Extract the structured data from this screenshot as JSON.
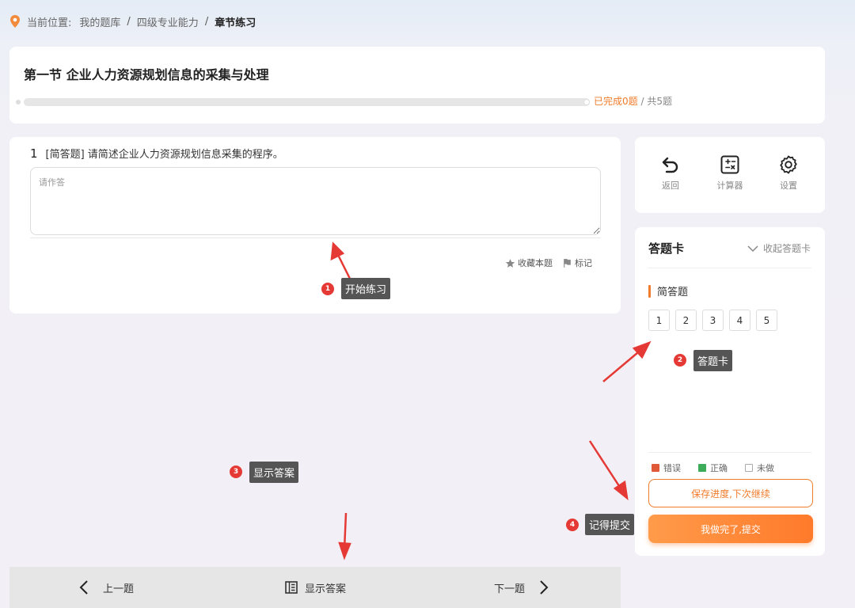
{
  "breadcrumb": {
    "prefix": "当前位置:",
    "items": [
      "我的题库",
      "四级专业能力",
      "章节练习"
    ]
  },
  "section": {
    "title": "第一节 企业人力资源规划信息的采集与处理",
    "progress_done": "已完成0题",
    "progress_sep": " / ",
    "progress_total": "共5题",
    "progress_fraction": 0
  },
  "question": {
    "number": "1",
    "type": "[简答题]",
    "text": "请简述企业人力资源规划信息采集的程序。",
    "placeholder": "请作答",
    "favorite_label": "收藏本题",
    "mark_label": "标记"
  },
  "tools": [
    {
      "label": "返回",
      "icon": "undo-icon"
    },
    {
      "label": "计算器",
      "icon": "calculator-icon"
    },
    {
      "label": "设置",
      "icon": "gear-icon"
    }
  ],
  "answer_sheet": {
    "title": "答题卡",
    "collapse_label": "收起答题卡",
    "section_label": "简答题",
    "numbers": [
      "1",
      "2",
      "3",
      "4",
      "5"
    ],
    "legend": [
      {
        "label": "错误",
        "color": "#e05a3a"
      },
      {
        "label": "正确",
        "color": "#3cab5a"
      },
      {
        "label": "未做",
        "color": "#ffffff"
      }
    ],
    "save_label": "保存进度,下次继续",
    "submit_label": "我做完了,提交"
  },
  "bottom_nav": {
    "prev_label": "上一题",
    "show_answer_label": "显示答案",
    "next_label": "下一题"
  },
  "annotations": [
    {
      "num": "1",
      "label": "开始练习"
    },
    {
      "num": "2",
      "label": "答题卡"
    },
    {
      "num": "3",
      "label": "显示答案"
    },
    {
      "num": "4",
      "label": "记得提交"
    }
  ],
  "colors": {
    "accent": "#f07b2a",
    "annotation_arrow": "#e53935"
  }
}
